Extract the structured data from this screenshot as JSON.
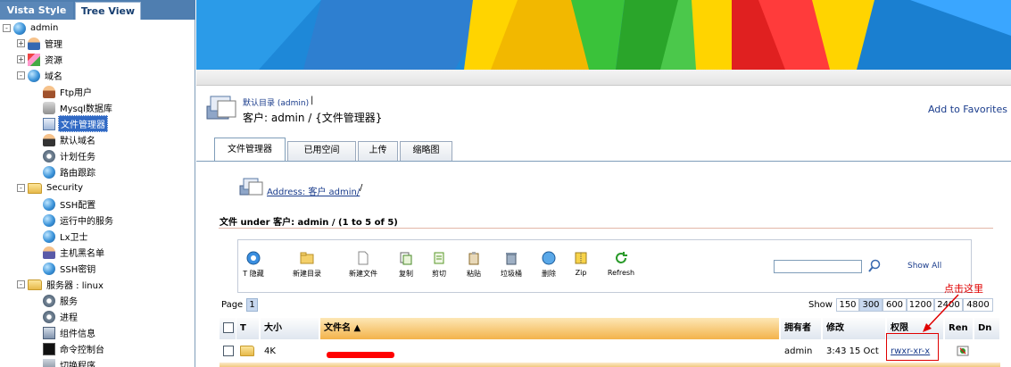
{
  "sidebar": {
    "tabs": [
      {
        "label": "Vista Style",
        "active": false
      },
      {
        "label": "Tree View",
        "active": true
      }
    ],
    "tree": {
      "root": {
        "label": "admin"
      },
      "items": [
        {
          "label": "管理",
          "icon": "user-admin-icon",
          "toggle": "+"
        },
        {
          "label": "资源",
          "icon": "resources-icon",
          "toggle": "+"
        },
        {
          "label": "域名",
          "icon": "globe-icon",
          "toggle": "-"
        },
        {
          "label": "Ftp用户",
          "icon": "ftp-users-icon"
        },
        {
          "label": "Mysql数据库",
          "icon": "database-icon"
        },
        {
          "label": "文件管理器",
          "icon": "file-manager-icon",
          "selected": true
        },
        {
          "label": "默认域名",
          "icon": "default-domain-icon"
        },
        {
          "label": "计划任务",
          "icon": "scheduled-tasks-icon"
        },
        {
          "label": "路由跟踪",
          "icon": "globe-icon"
        },
        {
          "label": "Security",
          "icon": "folder-icon",
          "toggle": "-"
        },
        {
          "label": "SSH配置",
          "icon": "globe-icon"
        },
        {
          "label": "运行中的服务",
          "icon": "globe-icon"
        },
        {
          "label": "Lx卫士",
          "icon": "globe-icon"
        },
        {
          "label": "主机黑名单",
          "icon": "blacklist-icon"
        },
        {
          "label": "SSH密钥",
          "icon": "globe-icon"
        },
        {
          "label": "服务器 : linux",
          "icon": "folder-icon",
          "toggle": "-"
        },
        {
          "label": "服务",
          "icon": "gear-icon"
        },
        {
          "label": "进程",
          "icon": "gear-icon"
        },
        {
          "label": "组件信息",
          "icon": "components-icon"
        },
        {
          "label": "命令控制台",
          "icon": "console-icon"
        },
        {
          "label": "切换程序",
          "icon": "switch-icon"
        }
      ]
    }
  },
  "header": {
    "breadcrumb_small": "默认目录 (admin)",
    "breadcrumb_sep": "|",
    "title": "客户: admin / {文件管理器}",
    "add_favorites": "Add to Favorites"
  },
  "tabs": [
    {
      "label": "文件管理器",
      "active": true
    },
    {
      "label": "已用空间",
      "active": false
    },
    {
      "label": "上传",
      "active": false
    },
    {
      "label": "缩略图",
      "active": false
    }
  ],
  "address": {
    "link": "Address: 客户 admin/",
    "suffix": "/"
  },
  "files_heading": "文件 under 客户: admin / (1 to 5 of 5)",
  "toolbar": {
    "items": [
      {
        "label": "T 隐藏",
        "icon": "hide-icon"
      },
      {
        "label": "新建目录",
        "icon": "new-folder-icon"
      },
      {
        "label": "新建文件",
        "icon": "new-file-icon"
      },
      {
        "label": "复制",
        "icon": "copy-icon"
      },
      {
        "label": "剪切",
        "icon": "cut-icon"
      },
      {
        "label": "粘贴",
        "icon": "paste-icon"
      },
      {
        "label": "垃圾桶",
        "icon": "trash-icon"
      },
      {
        "label": "删除",
        "icon": "delete-icon"
      },
      {
        "label": "Zip",
        "icon": "zip-icon"
      },
      {
        "label": "Refresh",
        "icon": "refresh-icon"
      }
    ],
    "search_value": "",
    "show_all": "Show All"
  },
  "paging": {
    "page_label": "Page",
    "current_page": "1",
    "show_label": "Show",
    "sizes": [
      "150",
      "300",
      "600",
      "1200",
      "2400",
      "4800"
    ],
    "active_size": "300"
  },
  "table": {
    "columns": [
      "T",
      "大小",
      "文件名 ▲",
      "拥有者",
      "修改",
      "权限",
      "Ren",
      "Dn"
    ],
    "rows": [
      {
        "type": "folder",
        "size": "4K",
        "name": "",
        "owner": "admin",
        "modified": "3:43 15 Oct",
        "permissions": "rwxr-xr-x"
      }
    ]
  },
  "annotation": {
    "text": "点击这里",
    "color": "#e00000"
  },
  "colors": {
    "accent": "#316ac5",
    "link": "#1a3c8c",
    "sort_header": "#f3b34b",
    "highlight_red": "#e00000"
  }
}
